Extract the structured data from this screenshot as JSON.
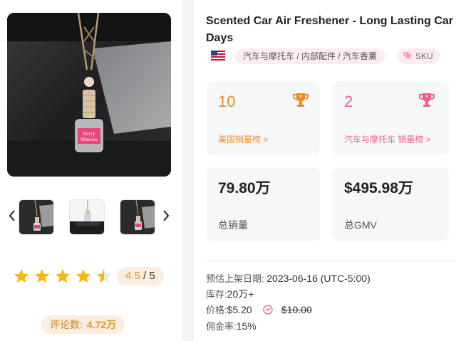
{
  "product": {
    "title_line1": "Scented Car Air Freshener - Long Lasting Car Diffuser",
    "title_line2": "Days",
    "flag_icon": "us-flag-icon",
    "category": "汽车与摩托车 / 内部配件 / 汽车香薰",
    "sku_label": "SKU",
    "bottle_label": "Berry Mimosa"
  },
  "gallery": {
    "prev_icon": "chevron-left-icon",
    "next_icon": "chevron-right-icon"
  },
  "rating": {
    "stars_filled": 4.5,
    "stars_total": 5,
    "value": "4.5",
    "max": "/ 5",
    "star_color": "#f6b80d"
  },
  "reviews": {
    "label": "评论数:",
    "count": "4.72万"
  },
  "cards": {
    "rank_us": {
      "value": "10",
      "label": "美国销量榜 >",
      "color": "#f08c1d"
    },
    "rank_category": {
      "value": "2",
      "label": "汽车与摩托车 销量榜 >",
      "color": "#ef5f8c"
    },
    "total_sales": {
      "value": "79.80万",
      "label": "总销量"
    },
    "total_gmv": {
      "value": "$495.98万",
      "label": "总GMV"
    }
  },
  "info": {
    "listed_label": "预估上架日期:",
    "listed_value": "2023-06-16 (UTC-5:00)",
    "stock_label": "库存:",
    "stock_value": "20万+",
    "price_label": "价格:",
    "price_value": "$5.20",
    "price_original": "$10.00",
    "commission_label": "佣金率:",
    "commission_value": "15%"
  }
}
